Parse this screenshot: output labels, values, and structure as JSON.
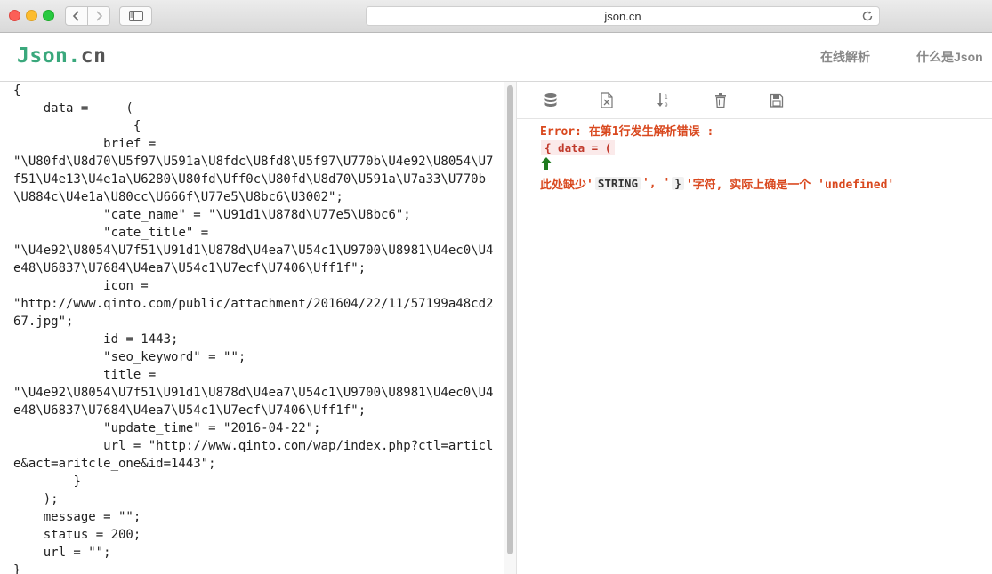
{
  "browser": {
    "url": "json.cn"
  },
  "site": {
    "logo_part1": "Json.",
    "logo_part2": "cn",
    "menu": {
      "parse_label": "在线解析",
      "what_label": "什么是Json"
    }
  },
  "editor": {
    "content": "{\n    data =     (\n                {\n            brief =\n\"\\U80fd\\U8d70\\U5f97\\U591a\\U8fdc\\U8fd8\\U5f97\\U770b\\U4e92\\U8054\\U7f51\\U4e13\\U4e1a\\U6280\\U80fd\\Uff0c\\U80fd\\U8d70\\U591a\\U7a33\\U770b\\U884c\\U4e1a\\U80cc\\U666f\\U77e5\\U8bc6\\U3002\";\n            \"cate_name\" = \"\\U91d1\\U878d\\U77e5\\U8bc6\";\n            \"cate_title\" =\n\"\\U4e92\\U8054\\U7f51\\U91d1\\U878d\\U4ea7\\U54c1\\U9700\\U8981\\U4ec0\\U4e48\\U6837\\U7684\\U4ea7\\U54c1\\U7ecf\\U7406\\Uff1f\";\n            icon =\n\"http://www.qinto.com/public/attachment/201604/22/11/57199a48cd267.jpg\";\n            id = 1443;\n            \"seo_keyword\" = \"\";\n            title =\n\"\\U4e92\\U8054\\U7f51\\U91d1\\U878d\\U4ea7\\U54c1\\U9700\\U8981\\U4ec0\\U4e48\\U6837\\U7684\\U4ea7\\U54c1\\U7ecf\\U7406\\Uff1f\";\n            \"update_time\" = \"2016-04-22\";\n            url = \"http://www.qinto.com/wap/index.php?ctl=article&act=aritcle_one&id=1443\";\n        }\n    );\n    message = \"\";\n    status = 200;\n    url = \"\";\n}"
  },
  "toolbar": {
    "icons": [
      "database-icon",
      "excel-icon",
      "sort-icon",
      "trash-icon",
      "save-icon"
    ]
  },
  "result": {
    "error_title": "Error: 在第1行发生解析错误 :",
    "error_code": "{ data = (",
    "msg_prefix": "此处缺少'",
    "token1": "STRING",
    "msg_mid": "', '",
    "token2": "}",
    "msg_suffix": "'字符, 实际上确是一个 'undefined'"
  },
  "colors": {
    "logo_green": "#3aa87c",
    "error_red": "#d9481e",
    "arrow_green": "#1f7a1f"
  }
}
